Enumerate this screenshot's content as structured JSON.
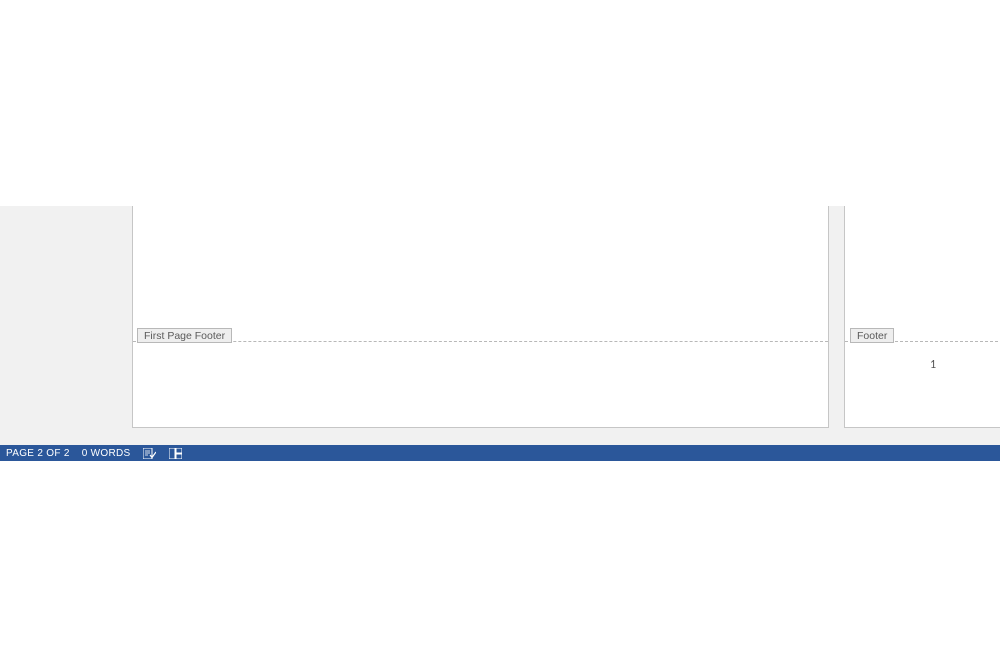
{
  "pages": {
    "page1": {
      "footer_label": "First Page Footer"
    },
    "page2": {
      "footer_label": "Footer",
      "footer_content": "1"
    }
  },
  "status_bar": {
    "page_info": "PAGE 2 OF 2",
    "word_count": "0 WORDS"
  }
}
